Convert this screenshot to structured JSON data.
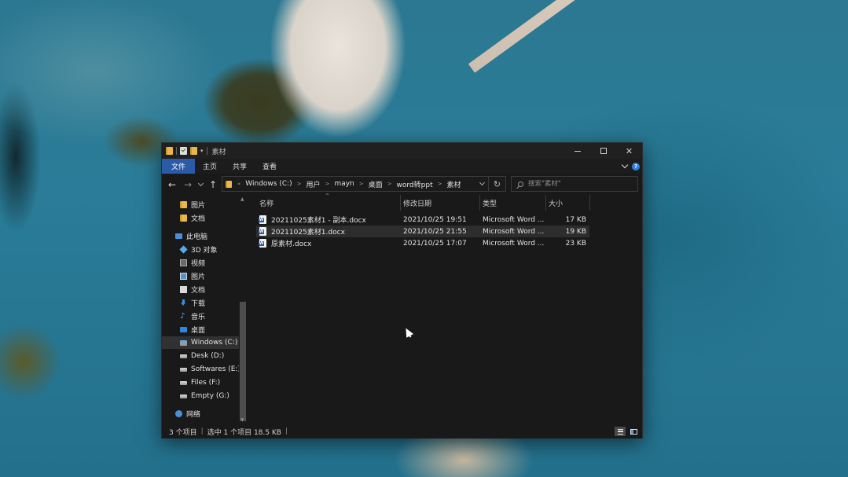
{
  "window": {
    "title": "素材",
    "quick_access_arrow": "▾"
  },
  "ribbon": {
    "tabs": [
      "文件",
      "主页",
      "共享",
      "查看"
    ],
    "help": "?"
  },
  "address": {
    "crumbs": [
      "Windows (C:)",
      "用户",
      "mayn",
      "桌面",
      "word转ppt",
      "素材"
    ],
    "lead_arrow": "«"
  },
  "search": {
    "placeholder": "搜索\"素材\""
  },
  "nav_pane": {
    "quick_items": [
      "图片",
      "文档"
    ],
    "this_pc": "此电脑",
    "pc_items": [
      "3D 对象",
      "视频",
      "图片",
      "文档",
      "下载",
      "音乐",
      "桌面"
    ],
    "drives": [
      "Windows (C:)",
      "Desk (D:)",
      "Softwares (E:)",
      "Files (F:)",
      "Empty (G:)"
    ],
    "network": "网络",
    "selected": "Windows (C:)"
  },
  "columns": {
    "name": "名称",
    "modified": "修改日期",
    "type": "类型",
    "size": "大小"
  },
  "files": [
    {
      "name": "20211025素材1 - 副本.docx",
      "modified": "2021/10/25 19:51",
      "type": "Microsoft Word ...",
      "size": "17 KB",
      "selected": false
    },
    {
      "name": "20211025素材1.docx",
      "modified": "2021/10/25 21:55",
      "type": "Microsoft Word ...",
      "size": "19 KB",
      "selected": true
    },
    {
      "name": "原素材.docx",
      "modified": "2021/10/25 17:07",
      "type": "Microsoft Word ...",
      "size": "23 KB",
      "selected": false
    }
  ],
  "status": {
    "item_count": "3 个项目",
    "selection": "选中 1 个项目  18.5 KB",
    "separator": "|"
  },
  "colors": {
    "accent": "#2b5aa6",
    "window_bg": "#191919",
    "selected_row": "#2d2d2d"
  }
}
